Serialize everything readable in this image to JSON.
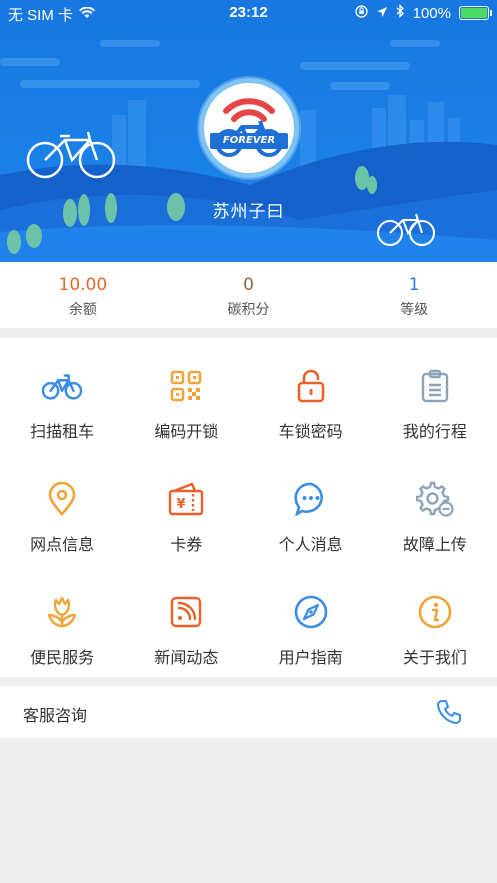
{
  "status_bar": {
    "carrier": "无 SIM 卡",
    "time": "23:12",
    "battery": "100%"
  },
  "profile": {
    "avatar_text": "FOREVER",
    "nickname": "苏州子曰"
  },
  "stats": [
    {
      "value": "10.00",
      "label": "余额",
      "color": "#e36b2c"
    },
    {
      "value": "0",
      "label": "碳积分",
      "color": "#8a6a4a"
    },
    {
      "value": "1",
      "label": "等级",
      "color": "#2a7fd4"
    }
  ],
  "menu": [
    {
      "label": "扫描租车",
      "icon": "bicycle-icon"
    },
    {
      "label": "编码开锁",
      "icon": "qr-code-icon"
    },
    {
      "label": "车锁密码",
      "icon": "lock-icon"
    },
    {
      "label": "我的行程",
      "icon": "clipboard-icon"
    },
    {
      "label": "网点信息",
      "icon": "location-pin-icon"
    },
    {
      "label": "卡券",
      "icon": "coupon-icon"
    },
    {
      "label": "个人消息",
      "icon": "message-icon"
    },
    {
      "label": "故障上传",
      "icon": "gear-icon"
    },
    {
      "label": "便民服务",
      "icon": "flower-icon"
    },
    {
      "label": "新闻动态",
      "icon": "rss-icon"
    },
    {
      "label": "用户指南",
      "icon": "compass-icon"
    },
    {
      "label": "关于我们",
      "icon": "info-icon"
    }
  ],
  "service": {
    "label": "客服咨询",
    "icon": "phone-icon"
  },
  "colors": {
    "hero_blue": "#1a7fe6",
    "blue_icon": "#3a8ee6",
    "orange_icon": "#f0a43a",
    "red_orange_icon": "#e8622a"
  }
}
